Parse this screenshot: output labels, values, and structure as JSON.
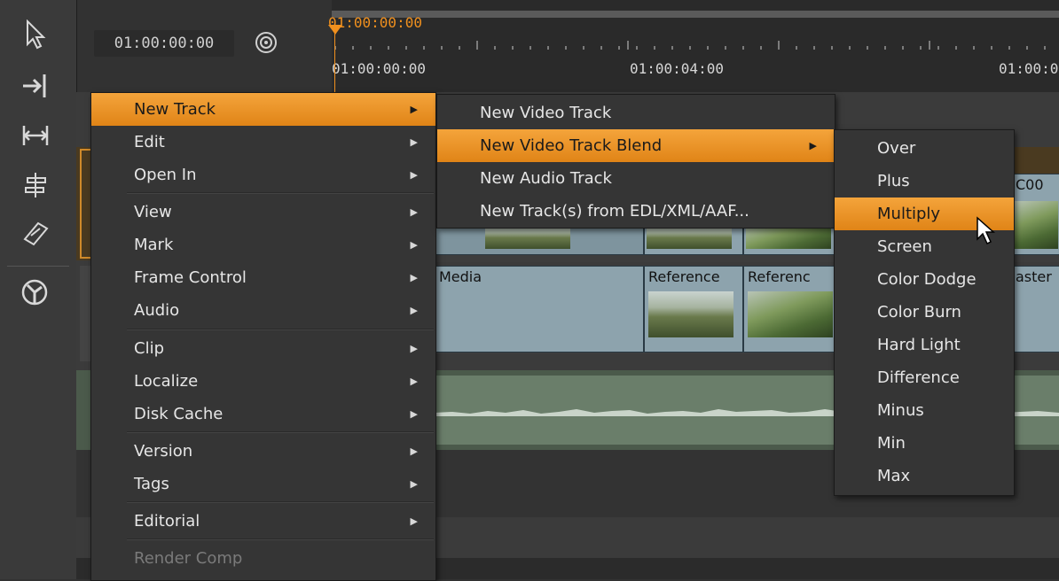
{
  "header": {
    "timecode": "01:00:00:00",
    "playhead_timecode": "01:00:00:00",
    "ruler_marks": [
      "01:00:00:00",
      "01:00:04:00",
      "01:00:0"
    ]
  },
  "toolbar": {
    "tools": [
      "select-icon",
      "track-select-icon",
      "slip-icon",
      "slide-icon",
      "razor-icon",
      "audio-sync-icon"
    ]
  },
  "tracks": {
    "clip_media_label": "Media",
    "clip_ref1_label": "Reference",
    "clip_ref2_label": "Referenc",
    "clip_right_label": "aster",
    "clip_top_right_label": "C00"
  },
  "context_menu": {
    "items": [
      {
        "label": "New Track",
        "submenu": true,
        "highlighted": true
      },
      {
        "label": "Edit",
        "submenu": true
      },
      {
        "label": "Open In",
        "submenu": true
      },
      {
        "label": "View",
        "submenu": true
      },
      {
        "label": "Mark",
        "submenu": true
      },
      {
        "label": "Frame Control",
        "submenu": true
      },
      {
        "label": "Audio",
        "submenu": true
      },
      {
        "label": "Clip",
        "submenu": true
      },
      {
        "label": "Localize",
        "submenu": true
      },
      {
        "label": "Disk Cache",
        "submenu": true
      },
      {
        "label": "Version",
        "submenu": true
      },
      {
        "label": "Tags",
        "submenu": true
      },
      {
        "label": "Editorial",
        "submenu": true
      },
      {
        "label": "Render Comp",
        "submenu": false,
        "disabled": true
      }
    ]
  },
  "new_track_menu": {
    "items": [
      {
        "label": "New Video Track"
      },
      {
        "label": "New Video Track Blend",
        "submenu": true,
        "highlighted": true
      },
      {
        "label": "New Audio Track"
      },
      {
        "label": "New Track(s) from EDL/XML/AAF..."
      }
    ]
  },
  "blend_menu": {
    "items": [
      {
        "label": "Over"
      },
      {
        "label": "Plus"
      },
      {
        "label": "Multiply",
        "highlighted": true
      },
      {
        "label": "Screen"
      },
      {
        "label": "Color Dodge"
      },
      {
        "label": "Color Burn"
      },
      {
        "label": "Hard Light"
      },
      {
        "label": "Difference"
      },
      {
        "label": "Minus"
      },
      {
        "label": "Min"
      },
      {
        "label": "Max"
      }
    ]
  },
  "colors": {
    "highlight": "#f0901e",
    "menu_bg": "#353535",
    "clip_bg": "#8da3ad"
  }
}
